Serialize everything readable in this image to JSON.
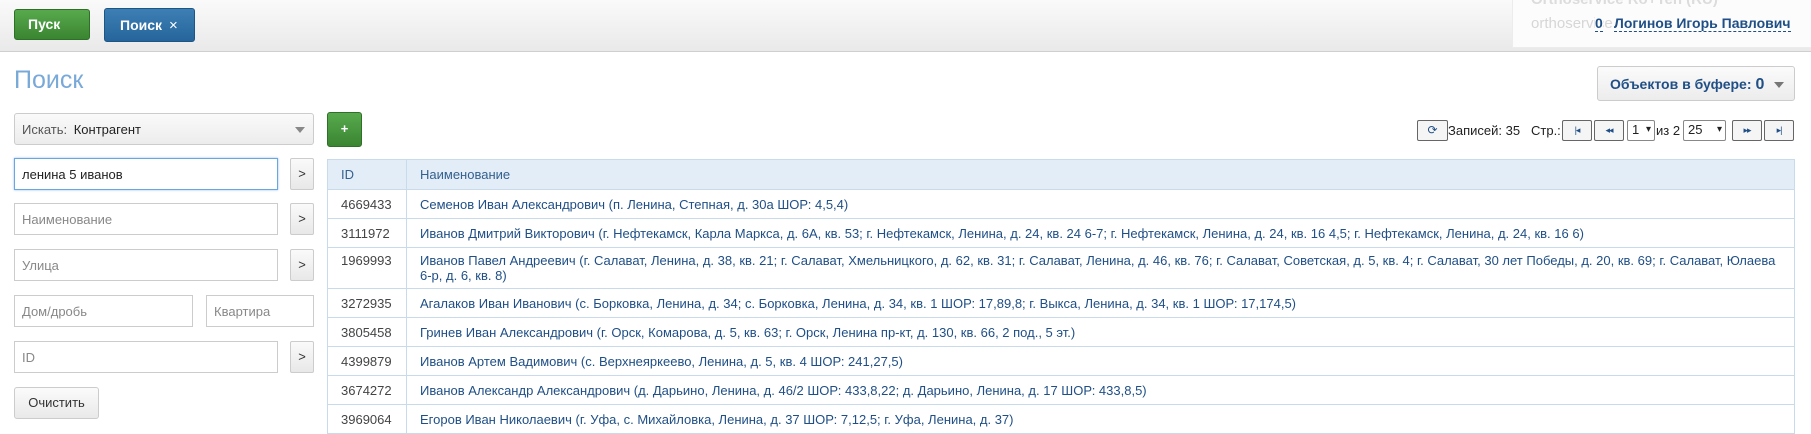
{
  "topbar": {
    "start_label": "Пуск",
    "search_tab_label": "Поиск",
    "close_glyph": "×",
    "user": {
      "ghost_line1": "Orthoservice Ro+Ten (RU)",
      "ghost_line2": "orthoservice",
      "count": "0",
      "name": "Логинов Игорь Павлович"
    }
  },
  "page": {
    "title": "Поиск",
    "buffer_label": "Объектов в буфере:",
    "buffer_count": "0"
  },
  "search": {
    "type_label": "Искать:",
    "type_value": "Контрагент",
    "add_label": "+",
    "go_label": ">",
    "query_value": "ленина 5 иванов",
    "name_placeholder": "Наименование",
    "street_placeholder": "Улица",
    "house_placeholder": "Дом/дробь",
    "apt_placeholder": "Квартира",
    "id_placeholder": "ID",
    "clear_label": "Очистить"
  },
  "pager": {
    "refresh_glyph": "⟳",
    "records_label": "Записей: 35",
    "page_label": "Стр.:",
    "first_glyph": "|◂",
    "prev_glyph": "◂◂",
    "page_value": "1",
    "of_label": "из 2",
    "per_page_value": "25",
    "next_glyph": "▸▸",
    "last_glyph": "▸|"
  },
  "table": {
    "columns": [
      "ID",
      "Наименование"
    ],
    "rows": [
      {
        "id": "4669433",
        "name": "Семенов Иван Александрович (п. Ленина, Степная, д. 30а ШОР: 4,5,4)"
      },
      {
        "id": "3111972",
        "name": "Иванов Дмитрий Викторович (г. Нефтекамск, Карла Маркса, д. 6А, кв. 53; г. Нефтекамск, Ленина, д. 24, кв. 24 6-7; г. Нефтекамск, Ленина, д. 24, кв. 16 4,5; г. Нефтекамск, Ленина, д. 24, кв. 16 6)"
      },
      {
        "id": "1969993",
        "name": "Иванов Павел Андреевич (г. Салават, Ленина, д. 38, кв. 21; г. Салават, Хмельницкого, д. 62, кв. 31; г. Салават, Ленина, д. 46, кв. 76; г. Салават, Советская, д. 5, кв. 4; г. Салават, 30 лет Победы, д. 20, кв. 69; г. Салават, Юлаева 6-р, д. 6, кв. 8)"
      },
      {
        "id": "3272935",
        "name": "Агалаков Иван Иванович (с. Борковка, Ленина, д. 34; с. Борковка, Ленина, д. 34, кв. 1 ШОР: 17,89,8; г. Выкса, Ленина, д. 34, кв. 1 ШОР: 17,174,5)"
      },
      {
        "id": "3805458",
        "name": "Гринев Иван Александрович (г. Орск, Комарова, д. 5, кв. 63; г. Орск, Ленина пр-кт, д. 130, кв. 66, 2 под., 5 эт.)"
      },
      {
        "id": "4399879",
        "name": "Иванов Артем Вадимович (с. Верхнеяркеево, Ленина, д. 5, кв. 4 ШОР: 241,27,5)"
      },
      {
        "id": "3674272",
        "name": "Иванов Александр Александрович (д. Дарьино, Ленина, д. 46/2 ШОР: 433,8,22; д. Дарьино, Ленина, д. 17 ШОР: 433,8,5)"
      },
      {
        "id": "3969064",
        "name": "Егоров Иван Николаевич (г. Уфа, с. Михайловка, Ленина, д. 37 ШОР: 7,12,5; г. Уфа, Ленина, д. 37)"
      }
    ]
  }
}
